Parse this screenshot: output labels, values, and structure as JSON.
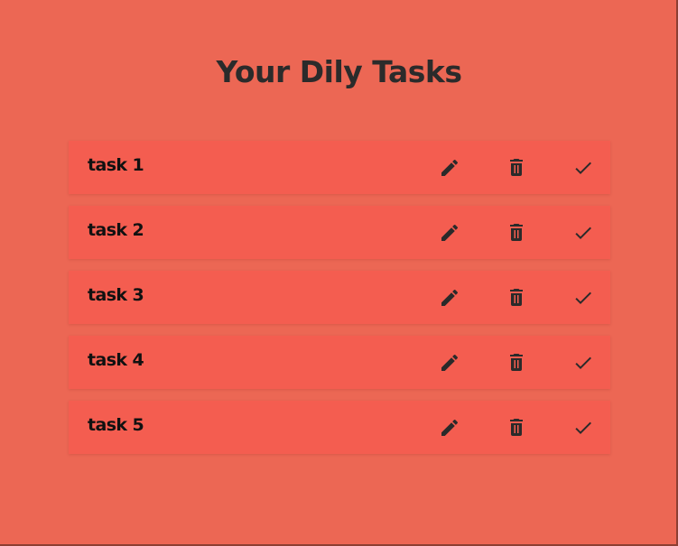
{
  "page": {
    "title": "Your Dily Tasks"
  },
  "tasks": [
    {
      "label": "task 1"
    },
    {
      "label": "task 2"
    },
    {
      "label": "task 3"
    },
    {
      "label": "task 4"
    },
    {
      "label": "task 5"
    }
  ],
  "icons": {
    "edit": "pencil-icon",
    "delete": "trash-icon",
    "complete": "checkmark-icon"
  },
  "colors": {
    "background": "#ec6754",
    "row": "#f45d50",
    "text": "#111111",
    "icon": "#2a2a2a"
  }
}
